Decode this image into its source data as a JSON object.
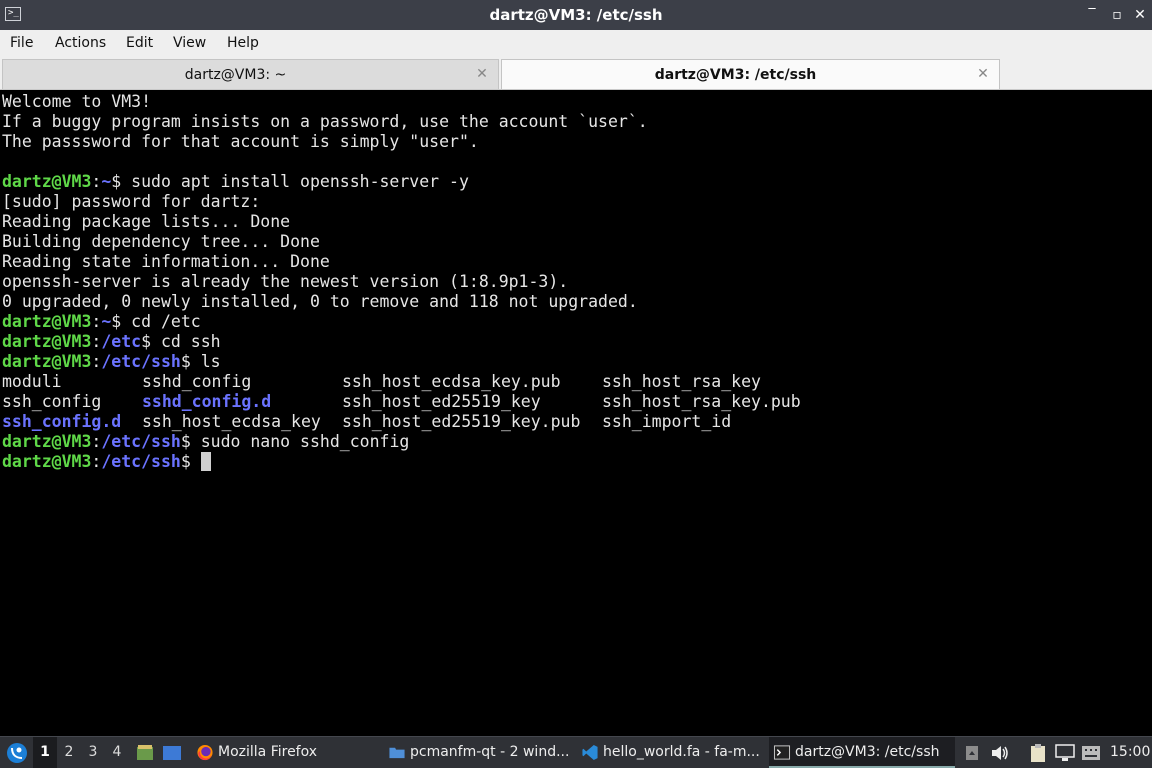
{
  "window": {
    "title": "dartz@VM3: /etc/ssh",
    "app_icon_glyph": ">_",
    "buttons": {
      "minimize": "‾",
      "maximize": "▫",
      "close": "✕"
    }
  },
  "menu": [
    "File",
    "Actions",
    "Edit",
    "View",
    "Help"
  ],
  "tabs": [
    {
      "label": "dartz@VM3: ~",
      "active": false
    },
    {
      "label": "dartz@VM3: /etc/ssh",
      "active": true
    }
  ],
  "tab_close_glyph": "✕",
  "terminal": {
    "colors": {
      "user_host": "#5fd948",
      "path": "#6b73ff",
      "text": "#e6e6e6",
      "background": "#000000"
    },
    "lines": [
      {
        "type": "text",
        "text": "Welcome to VM3!"
      },
      {
        "type": "text",
        "text": "If a buggy program insists on a password, use the account `user`."
      },
      {
        "type": "text",
        "text": "The passsword for that account is simply \"user\"."
      },
      {
        "type": "text",
        "text": ""
      },
      {
        "type": "prompt",
        "user_host": "dartz@VM3",
        "path": "~",
        "command": "sudo apt install openssh-server -y"
      },
      {
        "type": "text",
        "text": "[sudo] password for dartz:"
      },
      {
        "type": "text",
        "text": "Reading package lists... Done"
      },
      {
        "type": "text",
        "text": "Building dependency tree... Done"
      },
      {
        "type": "text",
        "text": "Reading state information... Done"
      },
      {
        "type": "text",
        "text": "openssh-server is already the newest version (1:8.9p1-3)."
      },
      {
        "type": "text",
        "text": "0 upgraded, 0 newly installed, 0 to remove and 118 not upgraded."
      },
      {
        "type": "prompt",
        "user_host": "dartz@VM3",
        "path": "~",
        "command": "cd /etc"
      },
      {
        "type": "prompt",
        "user_host": "dartz@VM3",
        "path": "/etc",
        "command": "cd ssh"
      },
      {
        "type": "prompt",
        "user_host": "dartz@VM3",
        "path": "/etc/ssh",
        "command": "ls"
      },
      {
        "type": "ls",
        "cells": [
          {
            "name": "moduli",
            "dir": false
          },
          {
            "name": "sshd_config",
            "dir": false
          },
          {
            "name": "ssh_host_ecdsa_key.pub",
            "dir": false
          },
          {
            "name": "ssh_host_rsa_key",
            "dir": false
          }
        ]
      },
      {
        "type": "ls",
        "cells": [
          {
            "name": "ssh_config",
            "dir": false
          },
          {
            "name": "sshd_config.d",
            "dir": true
          },
          {
            "name": "ssh_host_ed25519_key",
            "dir": false
          },
          {
            "name": "ssh_host_rsa_key.pub",
            "dir": false
          }
        ]
      },
      {
        "type": "ls",
        "cells": [
          {
            "name": "ssh_config.d",
            "dir": true
          },
          {
            "name": "ssh_host_ecdsa_key",
            "dir": false
          },
          {
            "name": "ssh_host_ed25519_key.pub",
            "dir": false
          },
          {
            "name": "ssh_import_id",
            "dir": false
          }
        ]
      },
      {
        "type": "prompt",
        "user_host": "dartz@VM3",
        "path": "/etc/ssh",
        "command": "sudo nano sshd_config"
      },
      {
        "type": "prompt",
        "user_host": "dartz@VM3",
        "path": "/etc/ssh",
        "command": "",
        "cursor": true
      }
    ]
  },
  "taskbar": {
    "workspaces": [
      "1",
      "2",
      "3",
      "4"
    ],
    "active_workspace": "1",
    "tasks": [
      {
        "label": "Mozilla Firefox",
        "icon": "firefox-icon",
        "active": false
      },
      {
        "label": "pcmanfm-qt - 2 wind...",
        "icon": "folder-icon",
        "active": false
      },
      {
        "label": "hello_world.fa - fa-m...",
        "icon": "vscode-icon",
        "active": false
      },
      {
        "label": "dartz@VM3: /etc/ssh",
        "icon": "terminal-icon",
        "active": true
      }
    ],
    "clock": "15:00"
  }
}
